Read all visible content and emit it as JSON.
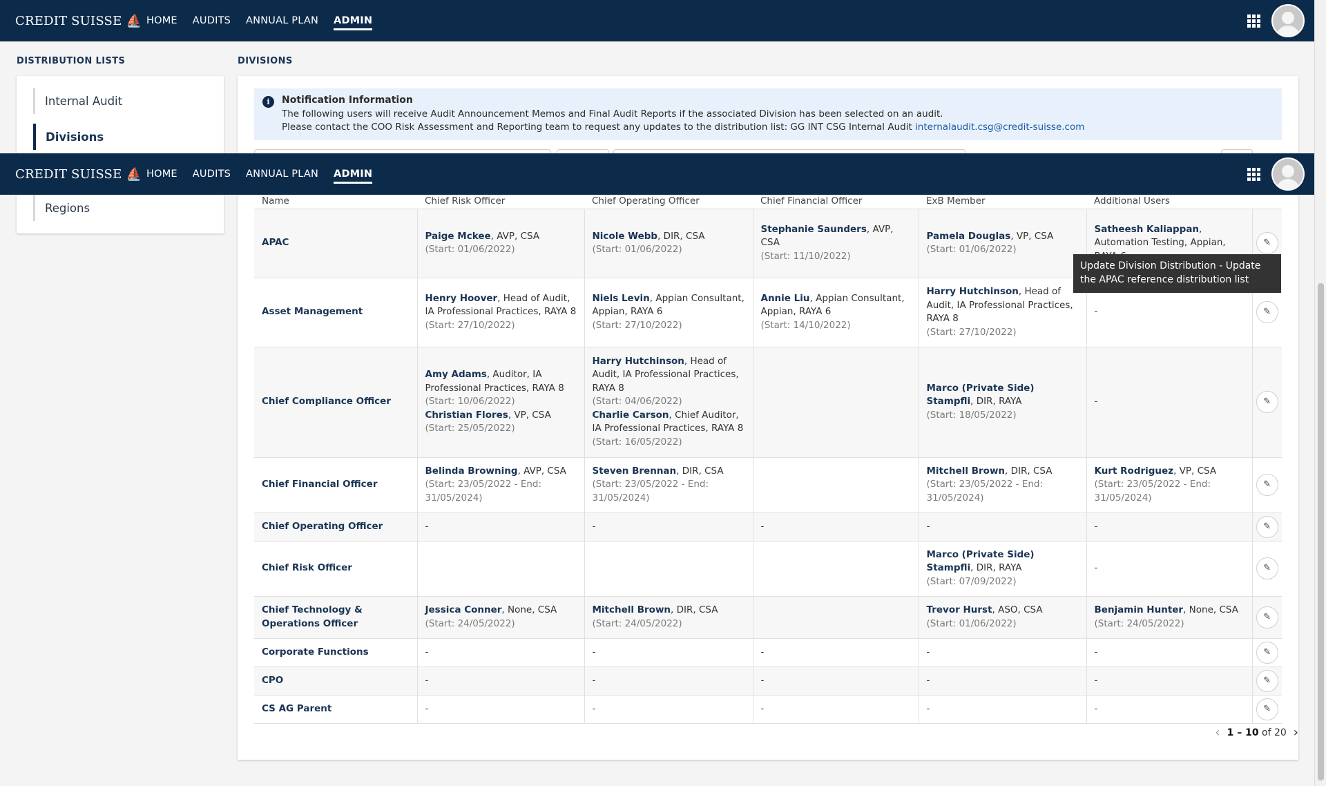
{
  "app": {
    "brand": "CREDIT SUISSE",
    "nav": [
      "HOME",
      "AUDITS",
      "ANNUAL PLAN",
      "ADMIN"
    ],
    "active_nav": "ADMIN"
  },
  "left": {
    "title": "DISTRIBUTION LISTS",
    "items": [
      "Internal Audit",
      "Divisions",
      "Regions"
    ],
    "active": "Divisions"
  },
  "main": {
    "title": "DIVISIONS",
    "notice": {
      "title": "Notification Information",
      "line1": "The following users will receive Audit Announcement Memos and Final Audit Reports if the associated Division has been selected on an audit.",
      "line2": "Please contact the COO Risk Assessment and Reporting team to request any updates to the distribution list: GG INT CSG Internal Audit ",
      "email": "internalaudit.csg@credit-suisse.com"
    },
    "columns": [
      "Name",
      "Chief Risk Officer",
      "Chief Operating Officer",
      "Chief Financial Officer",
      "ExB Member",
      "Additional Users"
    ]
  },
  "tooltip": "Update Division Distribution - Update the APAC reference distribution list",
  "rows": [
    {
      "name": "APAC",
      "cro": [
        {
          "n": "Paige Mckee",
          "d": ", AVP, CSA",
          "s": "(Start: 01/06/2022)"
        }
      ],
      "coo": [
        {
          "n": "Nicole Webb",
          "d": ", DIR, CSA",
          "s": "(Start: 01/06/2022)"
        }
      ],
      "cfo": [
        {
          "n": "Stephanie Saunders",
          "d": ", AVP, CSA",
          "s": "(Start: 11/10/2022)"
        }
      ],
      "exb": [
        {
          "n": "Pamela Douglas",
          "d": ", VP, CSA",
          "s": "(Start: 01/06/2022)"
        }
      ],
      "add": [
        {
          "n": "Satheesh Kaliappan",
          "d": ", Automation Testing, Appian, RAYA 6",
          "s": ""
        }
      ]
    },
    {
      "name": "Asset Management",
      "cro": [
        {
          "n": "Henry Hoover",
          "d": ", Head of Audit, IA Professional Practices, RAYA 8",
          "s": "(Start: 27/10/2022)"
        }
      ],
      "coo": [
        {
          "n": "Niels Levin",
          "d": ", Appian Consultant, Appian, RAYA 6",
          "s": "(Start: 27/10/2022)"
        }
      ],
      "cfo": [
        {
          "n": "Annie Liu",
          "d": ", Appian Consultant, Appian, RAYA 6",
          "s": "(Start: 14/10/2022)"
        }
      ],
      "exb": [
        {
          "n": "Harry Hutchinson",
          "d": ", Head of Audit, IA Professional Practices, RAYA 8",
          "s": "(Start: 27/10/2022)"
        }
      ],
      "add": "-"
    },
    {
      "name": "Chief Compliance Officer",
      "cro": [
        {
          "n": "Amy Adams",
          "d": ", Auditor, IA Professional Practices, RAYA 8",
          "s": "(Start: 10/06/2022)"
        },
        {
          "n": "Christian Flores",
          "d": ", VP, CSA",
          "s": "(Start: 25/05/2022)"
        }
      ],
      "coo": [
        {
          "n": "Harry Hutchinson",
          "d": ", Head of Audit, IA Professional Practices, RAYA 8",
          "s": "(Start: 04/06/2022)"
        },
        {
          "n": "Charlie Carson",
          "d": ", Chief Auditor, IA Professional Practices, RAYA 8",
          "s": "(Start: 16/05/2022)"
        }
      ],
      "cfo": "",
      "exb": [
        {
          "n": "Marco (Private Side) Stampfli",
          "d": ", DIR, RAYA",
          "s": "(Start: 18/05/2022)"
        }
      ],
      "add": "-"
    },
    {
      "name": "Chief Financial Officer",
      "cro": [
        {
          "n": "Belinda Browning",
          "d": ", AVP, CSA",
          "s": "(Start: 23/05/2022 - End: 31/05/2024)"
        }
      ],
      "coo": [
        {
          "n": "Steven Brennan",
          "d": ", DIR, CSA",
          "s": "(Start: 23/05/2022 - End: 31/05/2024)"
        }
      ],
      "cfo": "",
      "exb": [
        {
          "n": "Mitchell Brown",
          "d": ", DIR, CSA",
          "s": "(Start: 23/05/2022 - End: 31/05/2024)"
        }
      ],
      "add": [
        {
          "n": "Kurt Rodriguez",
          "d": ", VP, CSA",
          "s": "(Start: 23/05/2022 - End: 31/05/2024)"
        }
      ]
    },
    {
      "name": "Chief Operating Officer",
      "cro": "-",
      "coo": "-",
      "cfo": "-",
      "exb": "-",
      "add": "-"
    },
    {
      "name": "Chief Risk Officer",
      "cro": "",
      "coo": "",
      "cfo": "",
      "exb": [
        {
          "n": "Marco (Private Side) Stampfli",
          "d": ", DIR, RAYA",
          "s": "(Start: 07/09/2022)"
        }
      ],
      "add": "-"
    },
    {
      "name": "Chief Technology & Operations Officer",
      "cro": [
        {
          "n": "Jessica Conner",
          "d": ", None, CSA",
          "s": "(Start: 24/05/2022)"
        }
      ],
      "coo": [
        {
          "n": "Mitchell Brown",
          "d": ", DIR, CSA",
          "s": "(Start: 24/05/2022)"
        }
      ],
      "cfo": "",
      "exb": [
        {
          "n": "Trevor Hurst",
          "d": ", ASO, CSA",
          "s": "(Start: 01/06/2022)"
        }
      ],
      "add": [
        {
          "n": "Benjamin Hunter",
          "d": ", None, CSA",
          "s": "(Start: 24/05/2022)"
        }
      ]
    },
    {
      "name": "Corporate Functions",
      "cro": "-",
      "coo": "-",
      "cfo": "-",
      "exb": "-",
      "add": "-"
    },
    {
      "name": "CPO",
      "cro": "-",
      "coo": "-",
      "cfo": "-",
      "exb": "-",
      "add": "-"
    },
    {
      "name": "CS AG Parent",
      "cro": "-",
      "coo": "-",
      "cfo": "-",
      "exb": "-",
      "add": "-"
    }
  ],
  "pager": {
    "range": "1 – 10",
    "of": "of 20"
  },
  "icons": {
    "edit": "edit-icon",
    "info": "info-icon",
    "apps": "app-grid-icon",
    "user": "user-avatar"
  }
}
